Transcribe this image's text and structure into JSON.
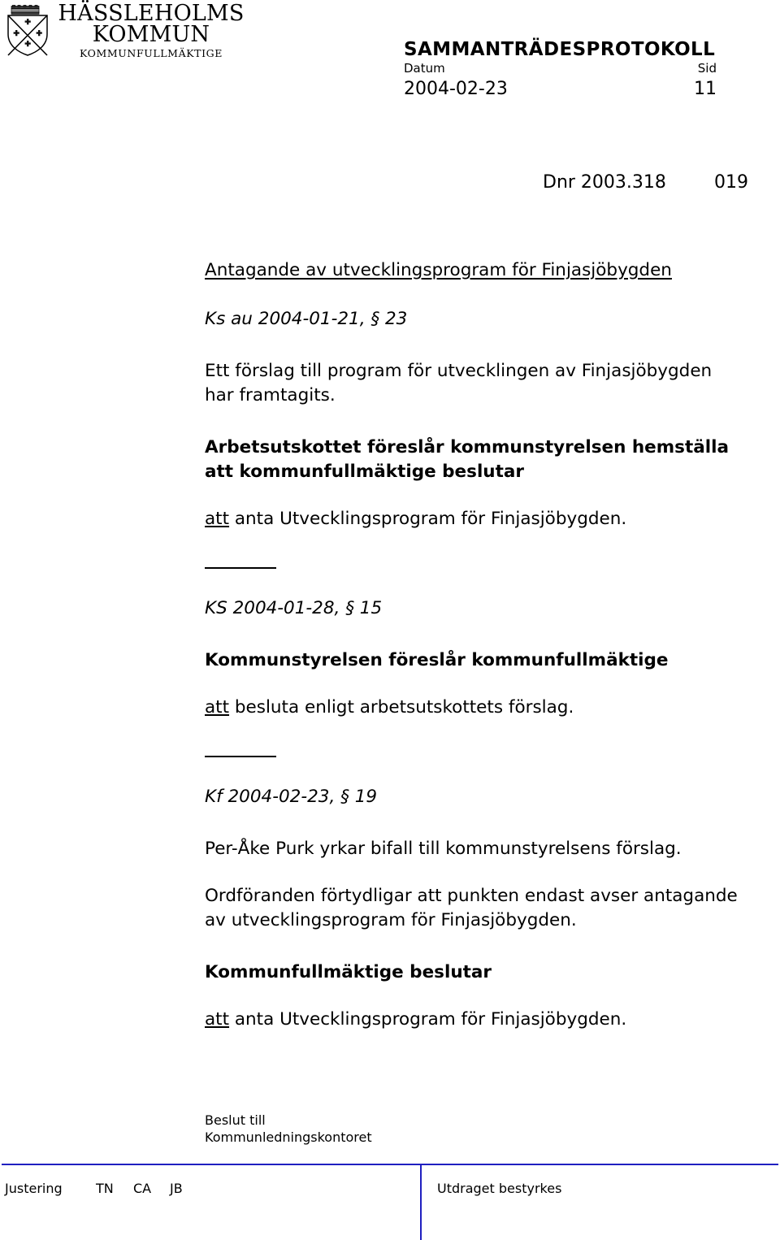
{
  "header": {
    "logo": {
      "icon": "coat-of-arms-shield-icon",
      "org_line_1": "HÄSSLEHOLMS",
      "org_line_2": "KOMMUN",
      "body_name": "KOMMUNFULLMÄKTIGE"
    },
    "document_type": "SAMMANTRÄDESPROTOKOLL",
    "date_label": "Datum",
    "date_value": "2004-02-23",
    "page_label": "Sid",
    "page_value": "11"
  },
  "dnr": {
    "number": "Dnr 2003.318",
    "suffix": "019"
  },
  "body": {
    "title": "Antagande av utvecklingsprogram för Finjasjöbygden",
    "ksau_ref": "Ks au 2004-01-21, § 23",
    "background_line_1": "Ett förslag till program för utvecklingen av Finjasjöbygden",
    "background_line_2": "har framtagits.",
    "ksau_proposal_line_1": "Arbetsutskottet föreslår kommunstyrelsen hemställa",
    "ksau_proposal_line_2": "att kommunfullmäktige beslutar",
    "ksau_att_prefix": "att",
    "ksau_att_text": " anta Utvecklingsprogram för Finjasjöbygden.",
    "ks_ref": "KS 2004-01-28, § 15",
    "ks_heading": "Kommunstyrelsen föreslår kommunfullmäktige",
    "ks_att_prefix": "att",
    "ks_att_text": " besluta enligt arbetsutskottets förslag.",
    "kf_ref": "Kf 2004-02-23, § 19",
    "kf_yrkande": "Per-Åke Purk yrkar bifall till kommunstyrelsens förslag.",
    "kf_clarification_line_1": "Ordföranden förtydligar att punkten endast avser antagande",
    "kf_clarification_line_2": "av utvecklingsprogram för Finjasjöbygden.",
    "kf_heading": "Kommunfullmäktige beslutar",
    "kf_att_prefix": "att",
    "kf_att_text": " anta Utvecklingsprogram för Finjasjöbygden."
  },
  "distribution": {
    "label": "Beslut till",
    "recipient": "Kommunledningskontoret"
  },
  "footer": {
    "justering_label": "Justering",
    "signatures": [
      "TN",
      "CA",
      "JB"
    ],
    "attestation": "Utdraget bestyrkes",
    "rule_color": "#2020c0"
  }
}
